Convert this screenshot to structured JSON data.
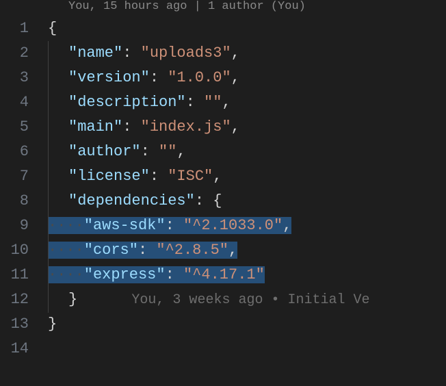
{
  "codelens": "You, 15 hours ago | 1 author (You)",
  "inline_blame": "You, 3 weeks ago • Initial Ve",
  "line_numbers": [
    "1",
    "2",
    "3",
    "4",
    "5",
    "6",
    "7",
    "8",
    "9",
    "10",
    "11",
    "12",
    "13",
    "14"
  ],
  "json": {
    "name_key": "\"name\"",
    "name_val": "\"uploads3\"",
    "version_key": "\"version\"",
    "version_val": "\"1.0.0\"",
    "description_key": "\"description\"",
    "description_val": "\"\"",
    "main_key": "\"main\"",
    "main_val": "\"index.js\"",
    "author_key": "\"author\"",
    "author_val": "\"\"",
    "license_key": "\"license\"",
    "license_val": "\"ISC\"",
    "deps_key": "\"dependencies\"",
    "dep1_key": "\"aws-sdk\"",
    "dep1_val": "\"^2.1033.0\"",
    "dep2_key": "\"cors\"",
    "dep2_val": "\"^2.8.5\"",
    "dep3_key": "\"express\"",
    "dep3_val": "\"^4.17.1\""
  },
  "punct": {
    "open_brace": "{",
    "close_brace": "}",
    "colon_sp": ": ",
    "comma": ","
  }
}
